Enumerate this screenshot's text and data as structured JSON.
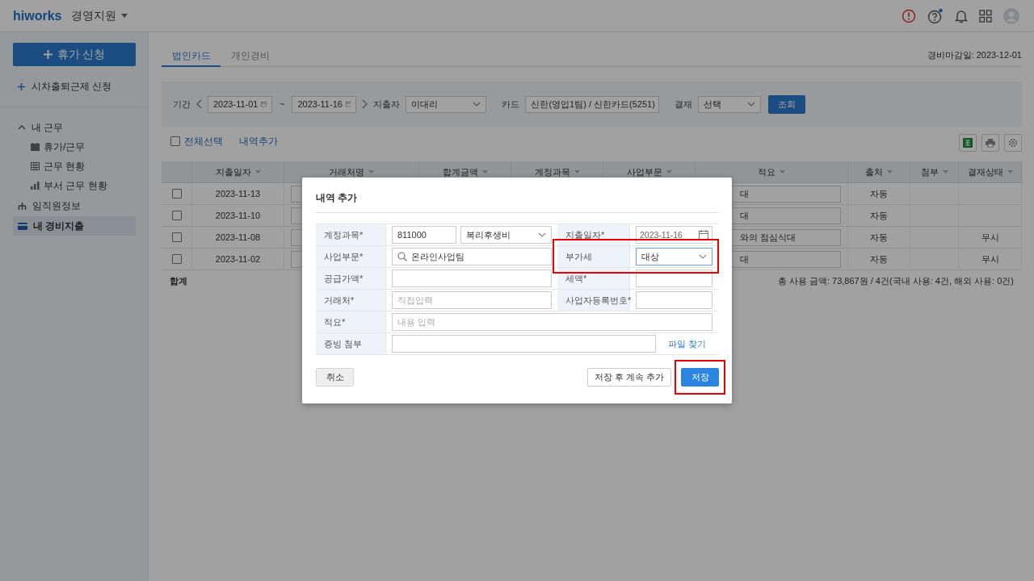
{
  "header": {
    "logo": "hiworks",
    "app": "경영지원"
  },
  "sidebar": {
    "primary_button": "휴가 신청",
    "secondary_link": "시차출퇴근제 신청",
    "items": [
      {
        "label": "내 근무",
        "expanded": true,
        "selected": false,
        "children": [
          {
            "label": "휴가/근무",
            "selected": false
          },
          {
            "label": "근무 현황",
            "selected": false
          },
          {
            "label": "부서 근무 현황",
            "selected": false
          }
        ]
      },
      {
        "label": "임직원정보",
        "selected": false
      },
      {
        "label": "내 경비지출",
        "selected": true
      }
    ]
  },
  "tabs": [
    {
      "label": "법인카드",
      "selected": true
    },
    {
      "label": "개인경비",
      "selected": false
    }
  ],
  "close_date": "경비마감일: 2023-12-01",
  "filters": {
    "period_label": "기간",
    "start": "2023-11-01",
    "separator": "~",
    "end": "2023-11-16",
    "spender_label": "지출자",
    "spender": "이대리",
    "card_label": "카드",
    "card": "신한(영업1팀) / 신한카드(5251)",
    "approval_label": "결재",
    "approval": "선택",
    "search_button": "조회"
  },
  "toolbar": {
    "select_all": {
      "label": "전체선택",
      "checked": false
    },
    "add_link": "내역추가"
  },
  "table": {
    "columns": [
      "지출일자",
      "거래처명",
      "합계금액",
      "계정과목",
      "사업부문",
      "적요",
      "출처",
      "첨부",
      "결재상태"
    ],
    "rows": [
      {
        "checked": false,
        "date": "2023-11-13",
        "memo": "대",
        "source": "자동"
      },
      {
        "checked": false,
        "date": "2023-11-10",
        "memo": "대",
        "source": "자동"
      },
      {
        "checked": false,
        "date": "2023-11-08",
        "memo": "와의 점심식대",
        "source": "자동",
        "status": "무시"
      },
      {
        "checked": false,
        "date": "2023-11-02",
        "memo": "대",
        "source": "자동",
        "status": "무시"
      }
    ],
    "total_label": "합계",
    "summary": "총 사용 금액: 73,867원 / 4건(국내 사용: 4건, 해외 사용: 0건)"
  },
  "modal": {
    "title": "내역 추가",
    "account": {
      "label": "계정과목*",
      "code": "811000",
      "name": "복리후생비"
    },
    "date": {
      "label": "지출일자*",
      "value": "2023-11-16"
    },
    "division": {
      "label": "사업부문*",
      "value": "온라인사업팀"
    },
    "vat": {
      "label": "부가세",
      "value": "대상",
      "highlighted": true
    },
    "supply": {
      "label": "공급가액*"
    },
    "tax": {
      "label": "세액*"
    },
    "vendor": {
      "label": "거래처*",
      "placeholder": "직접입력"
    },
    "bizno": {
      "label": "사업자등록번호*"
    },
    "memo": {
      "label": "적요*",
      "placeholder": "내용 입력"
    },
    "attach": {
      "label": "증빙 첨부",
      "link": "파일 찾기"
    },
    "cancel": "취소",
    "save_continue": "저장 후 계속 추가",
    "save": {
      "label": "저장",
      "highlighted": true
    }
  }
}
